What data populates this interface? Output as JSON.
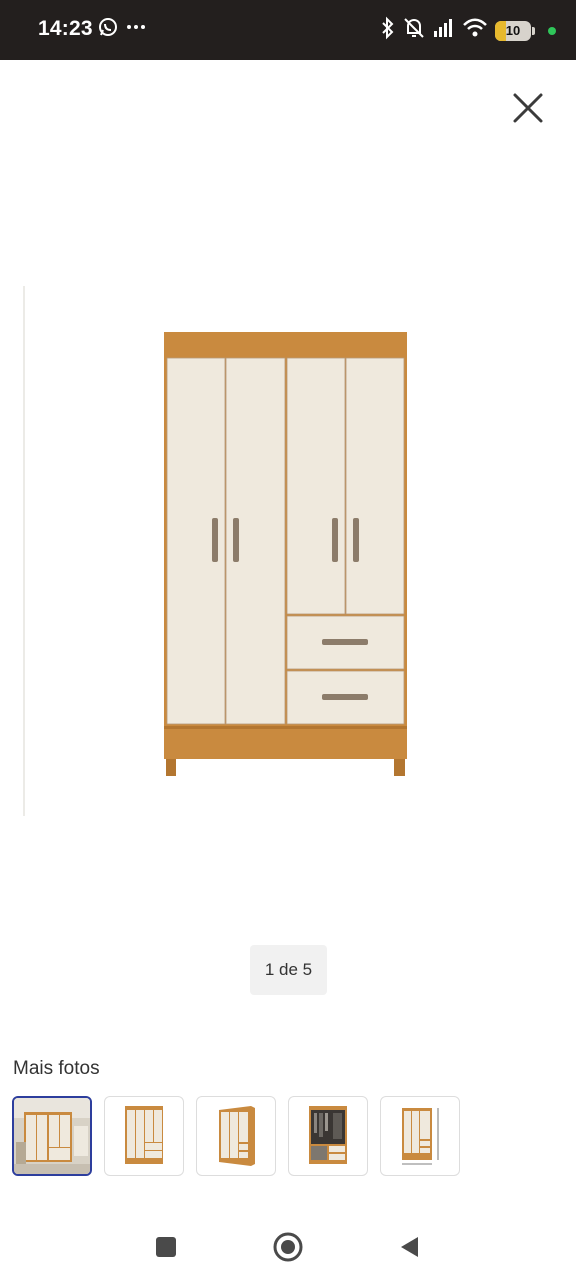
{
  "status_bar": {
    "time": "14:23",
    "left_icons": [
      "whatsapp-icon",
      "more-dots-icon"
    ],
    "right_icons": [
      "bluetooth-icon",
      "mute-vibrate-icon",
      "signal-icon",
      "wifi-icon"
    ],
    "battery_level": "10"
  },
  "viewer": {
    "close_icon": "close-icon",
    "main_image_alt": "wardrobe-image",
    "page_counter": "1 de 5"
  },
  "more_photos": {
    "title": "Mais fotos",
    "thumbnails": [
      {
        "name": "thumb-1",
        "selected": true
      },
      {
        "name": "thumb-2",
        "selected": false
      },
      {
        "name": "thumb-3",
        "selected": false
      },
      {
        "name": "thumb-4",
        "selected": false
      },
      {
        "name": "thumb-5",
        "selected": false
      }
    ]
  },
  "nav_bar": {
    "buttons": [
      "recents-button",
      "home-button",
      "back-button"
    ]
  },
  "colors": {
    "status_bar_bg": "#231f1e",
    "wood": "#c98a3f",
    "door": "#efe9dd",
    "selected_border": "#2d3e9d",
    "counter_bg": "#f1f1f1"
  }
}
